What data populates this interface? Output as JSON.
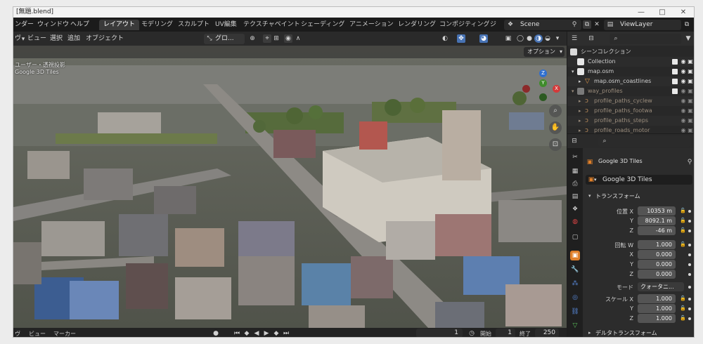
{
  "window": {
    "title": "[無題.blend]",
    "controls": {
      "minimize": "—",
      "maximize": "□",
      "close": "✕"
    }
  },
  "topbar": {
    "menus": [
      "ンダー",
      "ウィンドウ",
      "ヘルプ"
    ],
    "workspace_tabs": [
      "レイアウト",
      "モデリング",
      "スカルプト",
      "UV編集",
      "テクスチャペイント",
      "シェーディング",
      "アニメーション",
      "レンダリング",
      "コンポジティング",
      "ジ"
    ],
    "active_tab": "レイアウト",
    "scene": "Scene",
    "view_layer": "ViewLayer"
  },
  "viewport_header": {
    "menus": [
      "ビュー",
      "選択",
      "追加",
      "オブジェクト"
    ],
    "transform_orientation": "グロ...",
    "options_label": "オプション"
  },
  "viewport": {
    "overlay_line1": "ユーザー・透視投影",
    "overlay_line2": "Google 3D Tiles",
    "gizmo_axes": {
      "x": "X",
      "y": "Y",
      "z": "Z"
    }
  },
  "timeline": {
    "menus": [
      "ビュー",
      "マーカー"
    ],
    "current_frame": "1",
    "start_label": "開始",
    "start_value": "1",
    "end_label": "終了",
    "end_value": "250"
  },
  "outliner": {
    "search_placeholder": "",
    "rows": [
      {
        "label": "シーンコレクション",
        "kind": "scene"
      },
      {
        "label": "Collection",
        "kind": "collection"
      },
      {
        "label": "map.osm",
        "kind": "collection"
      },
      {
        "label": "map.osm_coastlines",
        "kind": "object"
      },
      {
        "label": "way_profiles",
        "kind": "collection-dim"
      },
      {
        "label": "profile_paths_cyclew",
        "kind": "curve-dim"
      },
      {
        "label": "profile_paths_footwa",
        "kind": "curve-dim"
      },
      {
        "label": "profile_paths_steps",
        "kind": "curve-dim"
      },
      {
        "label": "profile_roads_motor",
        "kind": "curve-dim"
      }
    ]
  },
  "properties": {
    "search_placeholder": "",
    "object_name": "Google 3D Tiles",
    "datablock_name": "Google 3D Tiles",
    "transform_panel": "トランスフォーム",
    "location_label": "位置 X",
    "location": {
      "x": "10353 m",
      "y": "8092.1 m",
      "z": "-46 m"
    },
    "rotation_label": "回転 W",
    "rotation": {
      "w": "1.000",
      "x": "0.000",
      "y": "0.000",
      "z": "0.000"
    },
    "mode_label": "モード",
    "mode_value": "クォータニ...",
    "scale_label": "スケール X",
    "scale": {
      "x": "1.000",
      "y": "1.000",
      "z": "1.000"
    },
    "delta_panel": "デルタトランスフォーム",
    "axis_labels": {
      "y": "Y",
      "z": "Z",
      "x": "X"
    }
  }
}
